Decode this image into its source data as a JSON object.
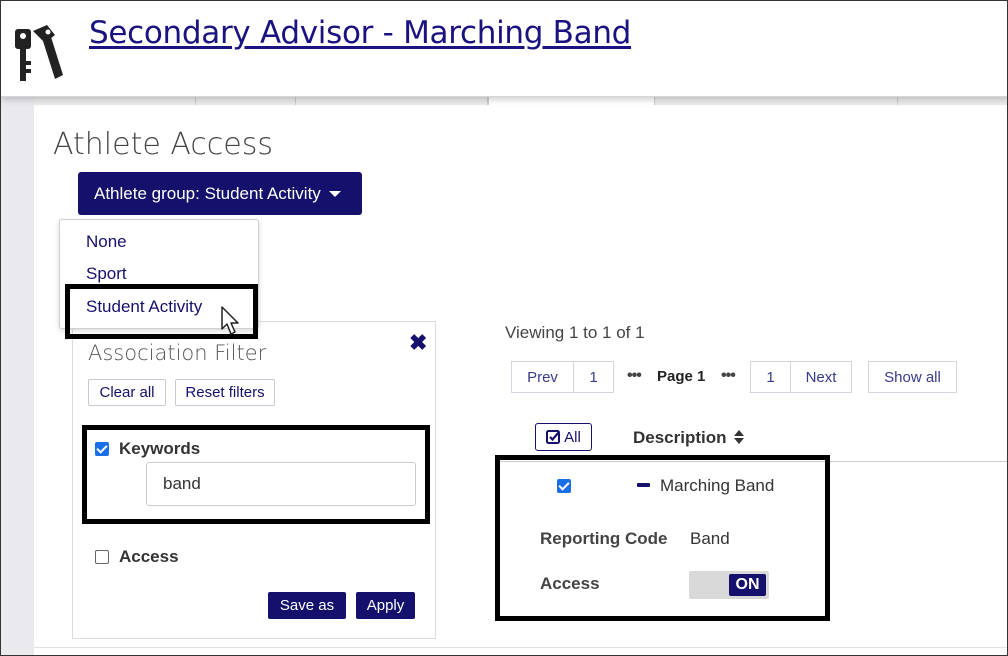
{
  "header": {
    "title": "Secondary Advisor - Marching Band",
    "logo_icon": "keys-icon"
  },
  "page": {
    "heading": "Athlete Access"
  },
  "group_dropdown": {
    "label": "Athlete group: Student Activity",
    "options": [
      "None",
      "Sport",
      "Student Activity"
    ],
    "highlighted": "Student Activity"
  },
  "filter": {
    "title": "Association Filter",
    "clear_all": "Clear all",
    "reset_filters": "Reset filters",
    "keywords_label": "Keywords",
    "keywords_checked": true,
    "keywords_value": "band",
    "access_label": "Access",
    "access_checked": false,
    "save_as": "Save as",
    "apply": "Apply"
  },
  "results": {
    "viewing": "Viewing 1 to 1 of 1",
    "pager": {
      "prev": "Prev",
      "first": "1",
      "ellipsis": "•••",
      "current": "Page 1",
      "last": "1",
      "next": "Next",
      "show_all": "Show all"
    },
    "select_all": "All",
    "description_header": "Description",
    "rows": [
      {
        "checked": true,
        "description": "Marching Band",
        "reporting_code_label": "Reporting Code",
        "reporting_code": "Band",
        "access_label": "Access",
        "access_state": "ON"
      }
    ]
  },
  "colors": {
    "primary": "#14106c",
    "checkbox": "#1a6ee8",
    "highlight_border": "#000000"
  }
}
